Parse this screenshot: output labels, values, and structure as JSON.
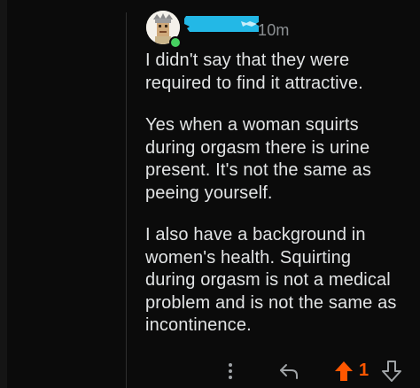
{
  "comment": {
    "username": "",
    "timestamp": "10m",
    "paragraphs": [
      "I didn't say that they were\nrequired to find it attractive.",
      "Yes when a woman squirts\nduring orgasm there is urine\npresent. It's not the same as\npeeing yourself.",
      "I also have a background in\nwomen's health. Squirting\nduring orgasm is not a medical\nproblem and is not the same as\nincontinence."
    ],
    "score": "1",
    "upvoted": true,
    "icons": {
      "avatar": "avatar-icon",
      "online": "online-indicator-icon",
      "more": "more-options-icon",
      "reply": "reply-icon",
      "upvote": "upvote-arrow-icon",
      "downvote": "downvote-arrow-icon"
    }
  },
  "colors": {
    "background": "#0b0b0b",
    "text": "#e2e4e5",
    "meta": "#8b8f92",
    "upvote": "#ff5700",
    "online": "#46d160",
    "redaction": "#23b8e6"
  }
}
